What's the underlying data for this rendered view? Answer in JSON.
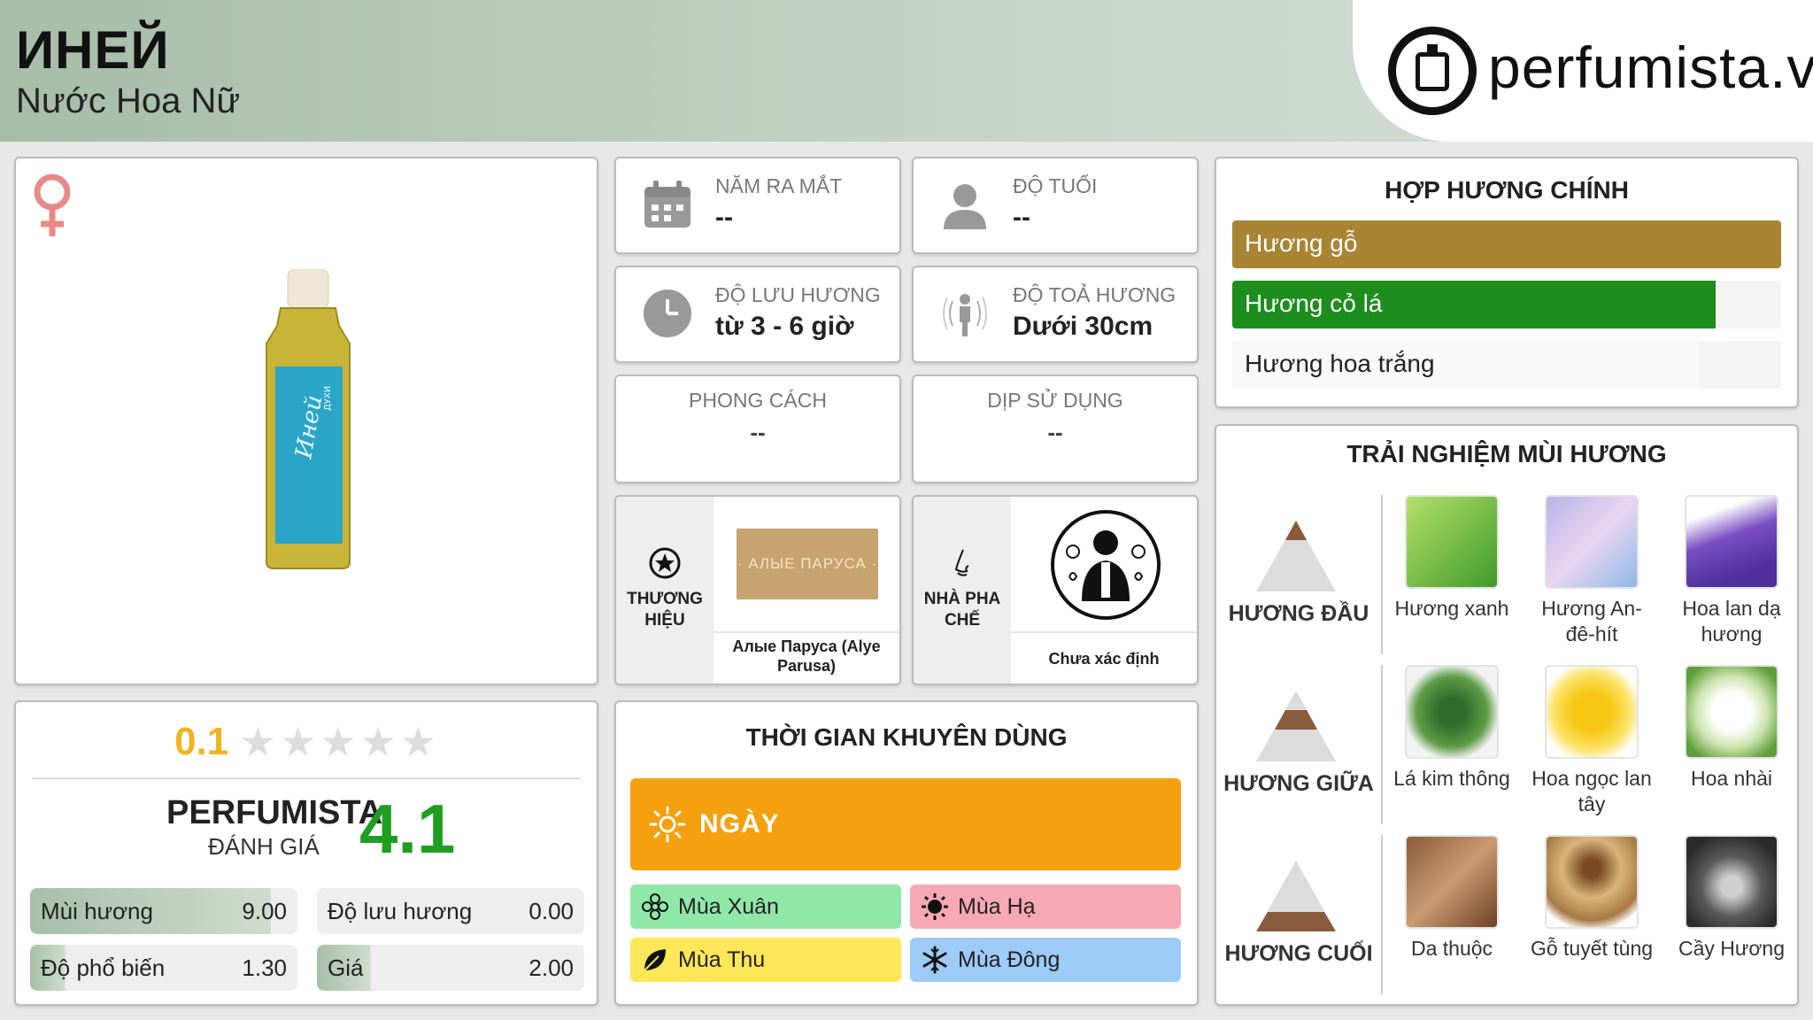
{
  "header": {
    "title": "ИНЕЙ",
    "subtitle": "Nước Hoa Nữ",
    "brand_site": "perfumista.vn"
  },
  "product": {
    "gender_icon": "female-symbol-icon",
    "bottle_label": "Иней",
    "bottle_label_small": "ДУХИ"
  },
  "rating": {
    "user_score": "0.1",
    "stars_filled_fraction": 0.02,
    "perfumista_label": "PERFUMISTA",
    "perfumista_sub": "ĐÁNH GIÁ",
    "perfumista_score": "4.1",
    "metrics": [
      {
        "label": "Mùi hương",
        "value": "9.00",
        "fraction": 0.9
      },
      {
        "label": "Độ lưu hương",
        "value": "0.00",
        "fraction": 0.0
      },
      {
        "label": "Độ phổ biến",
        "value": "1.30",
        "fraction": 0.13
      },
      {
        "label": "Giá",
        "value": "2.00",
        "fraction": 0.2
      }
    ]
  },
  "info": {
    "release_year": {
      "label": "NĂM RA MẮT",
      "value": "--"
    },
    "age": {
      "label": "ĐỘ TUỔI",
      "value": "--"
    },
    "longevity": {
      "label": "ĐỘ LƯU HƯƠNG",
      "value": "từ 3 - 6 giờ"
    },
    "sillage": {
      "label": "ĐỘ TOẢ HƯƠNG",
      "value": "Dưới 30cm"
    },
    "style": {
      "label": "PHONG CÁCH",
      "value": "--"
    },
    "occasion": {
      "label": "DỊP SỬ DỤNG",
      "value": "--"
    },
    "brand": {
      "label_line1": "THƯƠNG",
      "label_line2": "HIỆU",
      "logo_text": "· АЛЫЕ ПАРУСА ·",
      "name": "Алые Паруса (Alye Parusa)"
    },
    "perfumer": {
      "label_line1": "NHÀ PHA",
      "label_line2": "CHẾ",
      "name": "Chưa xác định"
    }
  },
  "time": {
    "title": "THỜI GIAN KHUYÊN DÙNG",
    "day_label": "NGÀY",
    "seasons": [
      {
        "label": "Mùa Xuân",
        "color": "#8fe8a8",
        "icon": "flower-icon"
      },
      {
        "label": "Mùa Hạ",
        "color": "#f8a8b4",
        "icon": "sun-icon"
      },
      {
        "label": "Mùa Thu",
        "color": "#fbe758",
        "icon": "leaf-icon"
      },
      {
        "label": "Mùa Đông",
        "color": "#9ccbf8",
        "icon": "snowflake-icon"
      }
    ]
  },
  "accords": {
    "title": "HỢP HƯƠNG CHÍNH",
    "items": [
      {
        "label": "Hương gỗ",
        "fraction": 1.0,
        "color": "#a98434",
        "text_color": "#ffffff"
      },
      {
        "label": "Hương cỏ lá",
        "fraction": 0.88,
        "color": "#1d8e1d",
        "text_color": "#ffffff"
      },
      {
        "label": "Hương hoa trắng",
        "fraction": 0.85,
        "color": "#f9f9f9",
        "text_color": "#222222"
      }
    ]
  },
  "notes": {
    "title": "TRẢI NGHIỆM MÙI HƯƠNG",
    "tiers": [
      {
        "label": "HƯƠNG ĐẦU",
        "items": [
          "Hương xanh",
          "Hương An-đê-hít",
          "Hoa lan dạ hương"
        ]
      },
      {
        "label": "HƯƠNG GIỮA",
        "items": [
          "Lá kim thông",
          "Hoa ngọc lan tây",
          "Hoa nhài"
        ]
      },
      {
        "label": "HƯƠNG CUỐI",
        "items": [
          "Da thuộc",
          "Gỗ tuyết tùng",
          "Cầy Hương"
        ]
      }
    ]
  }
}
